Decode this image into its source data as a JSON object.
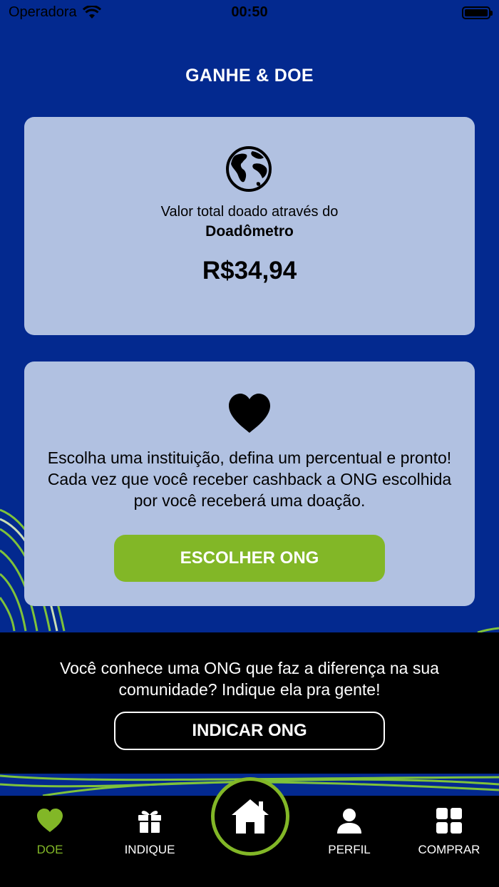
{
  "status_bar": {
    "carrier": "Operadora",
    "time": "00:50"
  },
  "page": {
    "title": "GANHE & DOE"
  },
  "donation_total": {
    "icon": "globe-icon",
    "label": "Valor total doado através do",
    "name": "Doadômetro",
    "value": "R$34,94"
  },
  "choose_ong": {
    "icon": "heart-icon",
    "description": "Escolha uma instituição, defina um percentual e pronto! Cada vez que você receber cashback a ONG escolhida por você receberá uma doação.",
    "button_label": "ESCOLHER ONG"
  },
  "indicate_banner": {
    "text": "Você conhece uma ONG que faz a diferença na sua comunidade? Indique ela pra gente!",
    "button_label": "INDICAR ONG"
  },
  "tab_bar": {
    "items": [
      {
        "label": "DOE",
        "icon": "heart-icon",
        "active": true
      },
      {
        "label": "INDIQUE",
        "icon": "gift-icon",
        "active": false
      },
      {
        "label": "",
        "icon": "home-icon",
        "active": false
      },
      {
        "label": "PERFIL",
        "icon": "user-icon",
        "active": false
      },
      {
        "label": "COMPRAR",
        "icon": "grid-icon",
        "active": false
      }
    ]
  },
  "colors": {
    "background": "#03298f",
    "card": "#b1c1e1",
    "accent": "#82b727",
    "banner": "#000000"
  }
}
